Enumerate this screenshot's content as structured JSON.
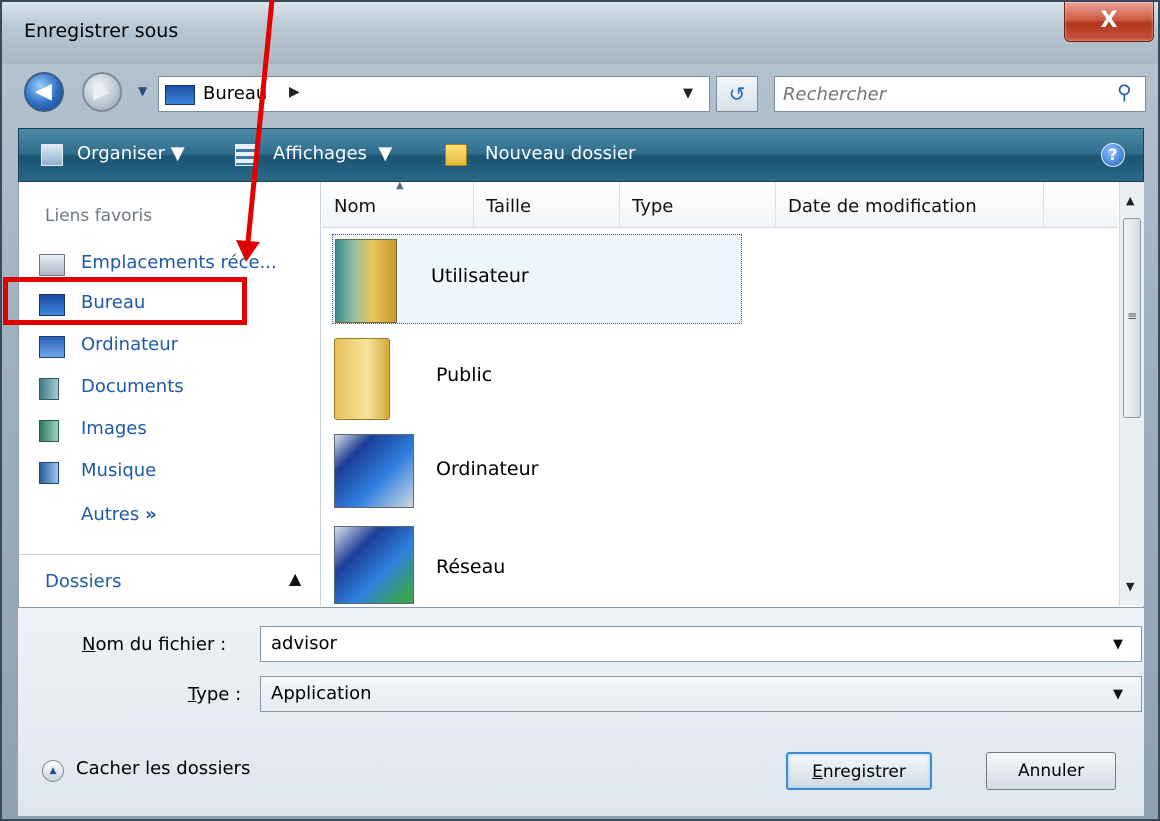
{
  "window": {
    "title": "Enregistrer sous",
    "close_glyph": "X"
  },
  "address": {
    "crumb": "Bureau",
    "search_placeholder": "Rechercher"
  },
  "toolbar": {
    "organize": "Organiser",
    "views": "Affichages",
    "new_folder": "Nouveau dossier",
    "help": "?"
  },
  "nav": {
    "favorites_title": "Liens favoris",
    "items": [
      {
        "label": "Emplacements réce...",
        "icon": "recent-places-icon"
      },
      {
        "label": "Bureau",
        "icon": "desktop-icon"
      },
      {
        "label": "Ordinateur",
        "icon": "computer-icon"
      },
      {
        "label": "Documents",
        "icon": "documents-icon"
      },
      {
        "label": "Images",
        "icon": "pictures-icon"
      },
      {
        "label": "Musique",
        "icon": "music-icon"
      }
    ],
    "others": "Autres",
    "others_glyph": "»",
    "folders": "Dossiers"
  },
  "list": {
    "columns": [
      "Nom",
      "Taille",
      "Type",
      "Date de modification"
    ],
    "items": [
      {
        "label": "Utilisateur",
        "icon": "user-folder-icon",
        "selected": true
      },
      {
        "label": "Public",
        "icon": "folder-icon"
      },
      {
        "label": "Ordinateur",
        "icon": "computer-icon"
      },
      {
        "label": "Réseau",
        "icon": "network-icon"
      }
    ]
  },
  "form": {
    "filename_label_key": "N",
    "filename_label_rest": "om du fichier :",
    "filename_value": "advisor",
    "type_label_key": "T",
    "type_label_rest": "ype :",
    "type_value": "Application"
  },
  "footer": {
    "hide_folders": "Cacher les dossiers",
    "save_key": "E",
    "save_rest": "nregistrer",
    "cancel": "Annuler"
  },
  "colors": {
    "annotation": "#e00000",
    "link": "#1f58a8",
    "command_bar": "#2f6d8c"
  }
}
